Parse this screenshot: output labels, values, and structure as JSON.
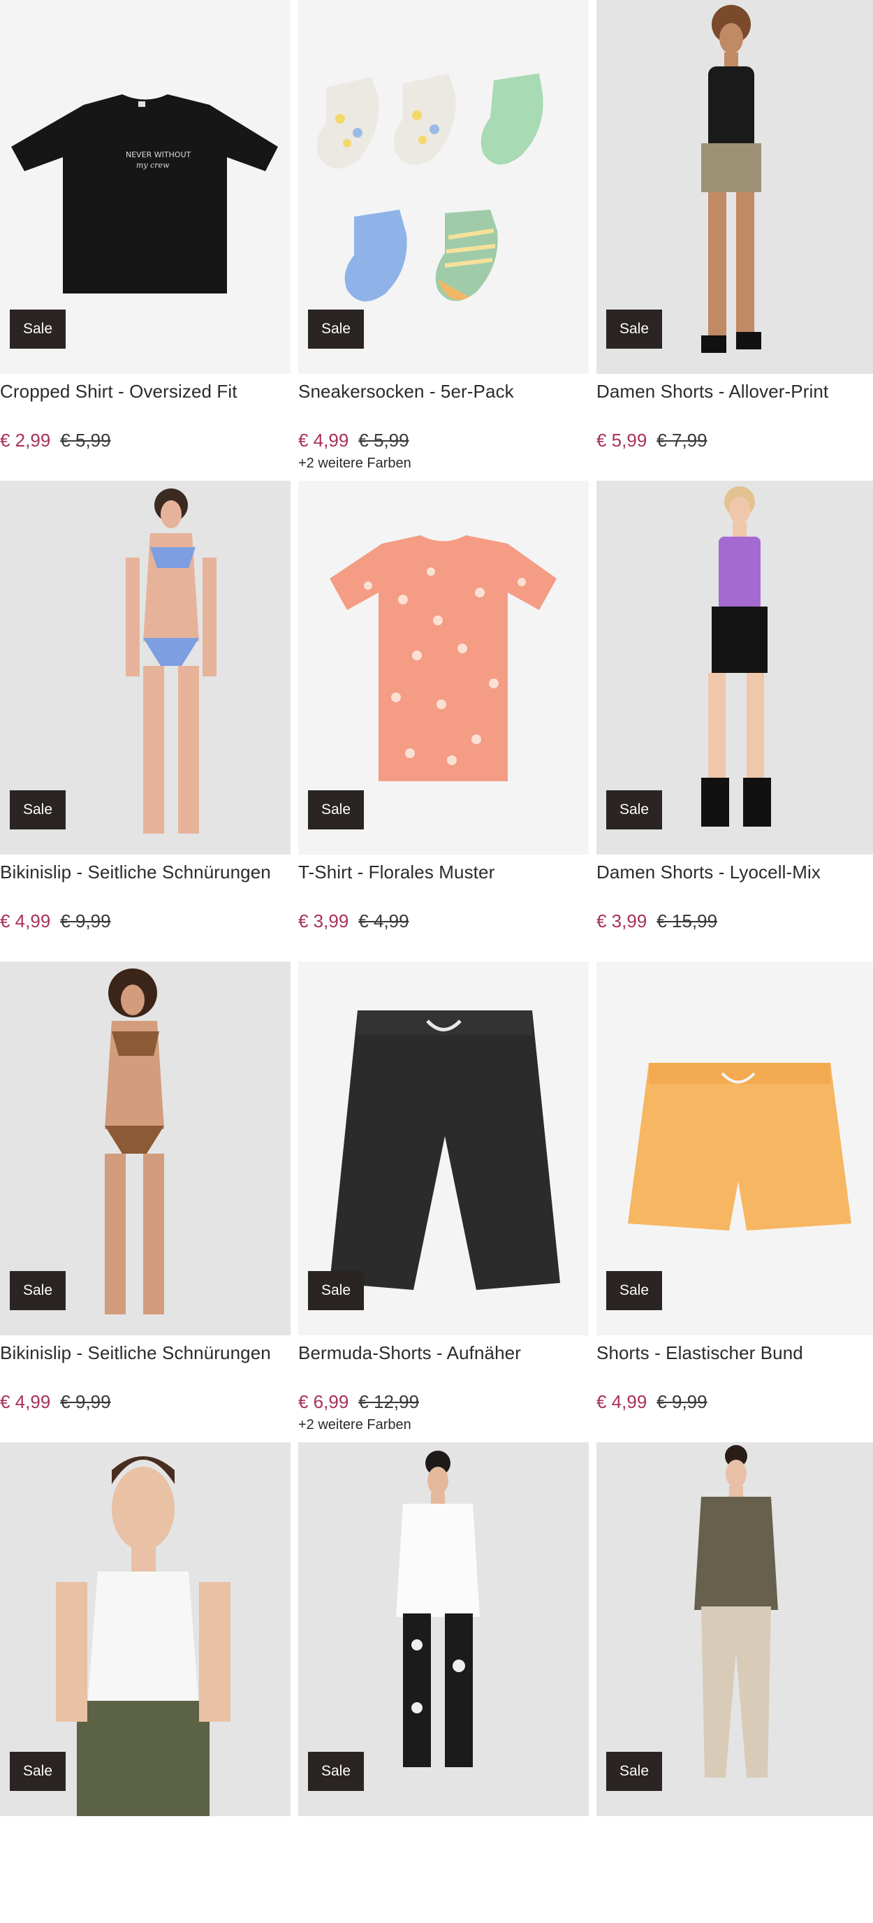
{
  "products": [
    {
      "title": "Cropped Shirt - Oversized Fit",
      "price": "€ 2,99",
      "old_price": "€ 5,99",
      "badge": "Sale",
      "colors_note": "",
      "image_icon": "black-tshirt-image"
    },
    {
      "title": "Sneakersocken - 5er-Pack",
      "price": "€ 4,99",
      "old_price": "€ 5,99",
      "badge": "Sale",
      "colors_note": "+2 weitere Farben",
      "image_icon": "socks-pack-image"
    },
    {
      "title": "Damen Shorts - Allover-Print",
      "price": "€ 5,99",
      "old_price": "€ 7,99",
      "badge": "Sale",
      "colors_note": "",
      "image_icon": "model-shorts-image"
    },
    {
      "title": "Bikinislip - Seitliche Schnürungen",
      "price": "€ 4,99",
      "old_price": "€ 9,99",
      "badge": "Sale",
      "colors_note": "",
      "image_icon": "model-bikini-blue-image"
    },
    {
      "title": "T-Shirt - Florales Muster",
      "price": "€ 3,99",
      "old_price": "€ 4,99",
      "badge": "Sale",
      "colors_note": "",
      "image_icon": "floral-tshirt-image"
    },
    {
      "title": "Damen Shorts - Lyocell-Mix",
      "price": "€ 3,99",
      "old_price": "€ 15,99",
      "badge": "Sale",
      "colors_note": "",
      "image_icon": "model-black-shorts-image"
    },
    {
      "title": "Bikinislip - Seitliche Schnürungen",
      "price": "€ 4,99",
      "old_price": "€ 9,99",
      "badge": "Sale",
      "colors_note": "",
      "image_icon": "model-bikini-leo-image"
    },
    {
      "title": "Bermuda-Shorts - Aufnäher",
      "price": "€ 6,99",
      "old_price": "€ 12,99",
      "badge": "Sale",
      "colors_note": "+2 weitere Farben",
      "image_icon": "black-bermuda-image"
    },
    {
      "title": "Shorts - Elastischer Bund",
      "price": "€ 4,99",
      "old_price": "€ 9,99",
      "badge": "Sale",
      "colors_note": "",
      "image_icon": "yellow-shorts-image"
    },
    {
      "title": "",
      "price": "",
      "old_price": "",
      "badge": "Sale",
      "colors_note": "",
      "image_icon": "model-white-top-image"
    },
    {
      "title": "",
      "price": "",
      "old_price": "",
      "badge": "Sale",
      "colors_note": "",
      "image_icon": "model-white-tee-leggings-image"
    },
    {
      "title": "",
      "price": "",
      "old_price": "",
      "badge": "Sale",
      "colors_note": "",
      "image_icon": "model-olive-tee-image"
    }
  ],
  "colors": {
    "sale_price": "#a8315b",
    "badge_bg": "#2a2422",
    "text": "#2b2b2b"
  }
}
